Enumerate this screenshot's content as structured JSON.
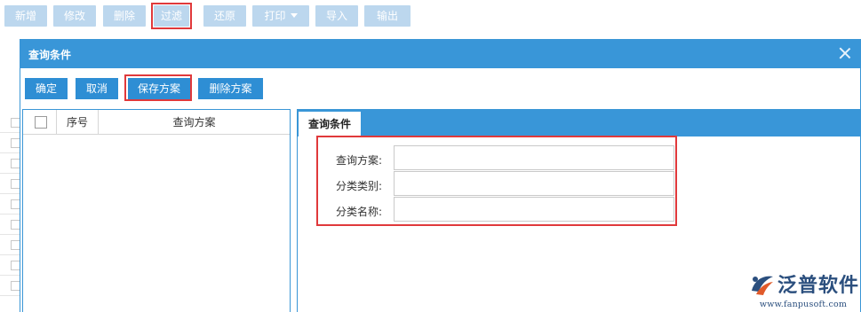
{
  "toolbar": {
    "buttons": [
      {
        "label": "新增"
      },
      {
        "label": "修改"
      },
      {
        "label": "删除"
      },
      {
        "label": "过滤"
      },
      {
        "label": "还原"
      },
      {
        "label": "打印"
      },
      {
        "label": "导入"
      },
      {
        "label": "输出"
      }
    ]
  },
  "dialog": {
    "title": "查询条件",
    "buttons": {
      "confirm": "确定",
      "cancel": "取消",
      "save_plan": "保存方案",
      "delete_plan": "删除方案"
    },
    "plan_list": {
      "columns": {
        "seq": "序号",
        "plan": "查询方案"
      },
      "rows": []
    },
    "tab": "查询条件",
    "fields": [
      {
        "label": "查询方案:",
        "value": ""
      },
      {
        "label": "分类类别:",
        "value": ""
      },
      {
        "label": "分类名称:",
        "value": ""
      }
    ]
  },
  "watermark": {
    "name": "泛普软件",
    "url": "www.fanpusoft.com"
  },
  "colors": {
    "header_blue": "#3996d8",
    "button_blue": "#2e8ed4",
    "toolbar_button": "#bcd7ee",
    "highlight_red": "#e0393b",
    "logo_navy": "#2b4f7e"
  }
}
